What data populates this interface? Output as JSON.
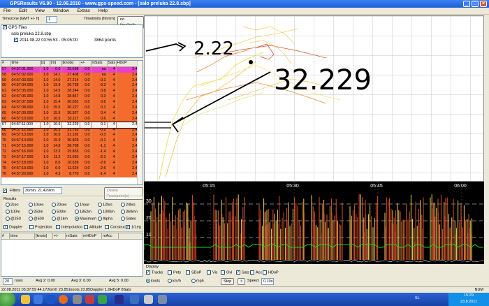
{
  "window": {
    "title": "GPSResults V6.90 - 12.06.2010 - www.gps-speed.com - [salo preluka 22.8.sbp]"
  },
  "menu": [
    "File",
    "Edit",
    "View",
    "Window",
    "Extras",
    "Help"
  ],
  "toolbar": {
    "timezone_label": "Timezone [GMT +/- h]",
    "timezone_value": "1",
    "timelimits_label": "Timelimits [hhmm]",
    "timelimits_button": "no timelimits"
  },
  "tree": {
    "root": "GPS Files",
    "file": "salo preluka 22.8.sbp",
    "session": "2011.08.22 03:55:53 - 05:05:00",
    "points": "3864 points"
  },
  "grid": {
    "columns": [
      "#",
      "time",
      "[s]",
      "[m]",
      "[knots]",
      "+/-",
      "mSats",
      "Sats",
      "HDoP"
    ],
    "rows": [
      [
        "57",
        "04:57:01.000",
        "1.0",
        "0.0",
        "25.698",
        "0.0",
        "na",
        "4",
        "2.4"
      ],
      [
        "58",
        "04:57:02.000",
        "1.0",
        "14.1",
        "27.408",
        "0.0",
        "na",
        "4",
        "2.4"
      ],
      [
        "59",
        "04:57:03.000",
        "1.0",
        "14.0",
        "27.214",
        "0.0",
        "-0.1",
        "4",
        "2.4"
      ],
      [
        "60",
        "04:57:04.000",
        "1.0",
        "13.9",
        "26.728",
        "0.0",
        "-0.3",
        "4",
        "2.4"
      ],
      [
        "61",
        "04:57:05.000",
        "1.0",
        "14.5",
        "28.244",
        "0.0",
        "0.8",
        "4",
        "2.4"
      ],
      [
        "62",
        "04:57:06.000",
        "1.0",
        "14.8",
        "28.847",
        "0.0",
        "0.3",
        "4",
        "2.4"
      ],
      [
        "63",
        "04:57:07.000",
        "1.0",
        "15.4",
        "30.052",
        "0.0",
        "0.6",
        "4",
        "2.4"
      ],
      [
        "64",
        "04:57:08.000",
        "1.0",
        "15.5",
        "30.227",
        "0.0",
        "0.1",
        "4",
        "2.4"
      ],
      [
        "65",
        "04:57:09.000",
        "1.0",
        "15.9",
        "30.927",
        "0.0",
        "0.4",
        "4",
        "2.4"
      ],
      [
        "66",
        "04:57:10.000",
        "1.0",
        "16.5",
        "32.117",
        "0.0",
        "0.6",
        "4",
        "2.4"
      ],
      [
        "67",
        "04:57:11.000",
        "1.0",
        "16.6",
        "32.229",
        "0.0",
        "0.1",
        "4",
        "2.4"
      ],
      [
        "68",
        "04:57:12.000",
        "1.0",
        "16.3",
        "31.762",
        "0.0",
        "-0.2",
        "4",
        "2.4"
      ],
      [
        "69",
        "04:57:13.000",
        "1.0",
        "16.0",
        "31.102",
        "0.0",
        "-0.3",
        "4",
        "2.4"
      ],
      [
        "70",
        "04:57:14.000",
        "1.0",
        "15.9",
        "30.829",
        "0.0",
        "-0.1",
        "4",
        "2.4"
      ],
      [
        "71",
        "04:57:15.000",
        "1.0",
        "14.8",
        "28.708",
        "0.0",
        "-1.1",
        "4",
        "2.4"
      ],
      [
        "72",
        "04:57:16.000",
        "1.0",
        "13.3",
        "25.853",
        "0.0",
        "-1.4",
        "4",
        "2.4"
      ],
      [
        "73",
        "04:57:17.000",
        "1.0",
        "11.2",
        "21.693",
        "0.0",
        "-2.1",
        "4",
        "2.4"
      ],
      [
        "74",
        "04:57:18.000",
        "1.0",
        "8.6",
        "16.639",
        "0.0",
        "-2.6",
        "4",
        "2.4"
      ],
      [
        "75",
        "04:57:19.000",
        "1.0",
        "6.0",
        "11.624",
        "0.0",
        "-2.6",
        "4",
        "2.4"
      ],
      [
        "76",
        "04:57:20.000",
        "1.0",
        "4.5",
        "8.770",
        "0.0",
        "-1.4",
        "4",
        "2.4"
      ]
    ]
  },
  "filters": {
    "label": "Filters",
    "value": "36min, 21.429km",
    "delete_button": "Delete Trackpoint(s)"
  },
  "results": {
    "label": "Results",
    "options": [
      "2sec",
      "10sec",
      "20sec",
      "1hour",
      "12hrs",
      "24hrs",
      "100m",
      "250m",
      "500m",
      "1852m",
      "1000m",
      "360mn",
      "@250",
      "@500",
      "@1km",
      "Maximum",
      "Alpha",
      "Gates"
    ],
    "selected": "Maximum",
    "checks": [
      "Doppler",
      "Projection",
      "Interpolation",
      "Altitude",
      "Construct",
      "1/Leg"
    ]
  },
  "resgrid": {
    "columns": [
      "#",
      "time",
      "[knots]",
      "+/-",
      "mSats",
      "mHDoP",
      "mAcc"
    ]
  },
  "footer": {
    "rows_value": "20",
    "rows_label": "rows",
    "avg2": "Avg 2:",
    "avg3": "Avg 3:",
    "avg5": "Avg 5:",
    "avg2_value": "0.00",
    "avg3_value": "0.00",
    "avg5_value": "0.00"
  },
  "annotations": {
    "big_number": "32.229",
    "small_number": "2.22"
  },
  "speedgraph": {
    "time_labels": [
      "05:15",
      "05:30",
      "05:45",
      "06:00"
    ],
    "y_labels": [
      "30",
      "20",
      "10"
    ]
  },
  "display": {
    "label": "Display",
    "checks": [
      "Tracks",
      "Pnts",
      "SDoP",
      "Vic",
      "Ovl",
      "Sats",
      "Acc",
      "HDoP"
    ],
    "units": [
      "knots",
      "km/h",
      "mph"
    ],
    "stop": "Stop",
    "speed_label": "Speed",
    "speed_value": "0.10s"
  },
  "status": {
    "text": "22.08.2011 05:37:59 44.172km/h 23.851knots 23.85Doppler 1.0HDoP 8Sats"
  },
  "tray": {
    "lang": "SL",
    "time": "15:29",
    "date": "23.8.2011",
    "num": "NUM"
  }
}
